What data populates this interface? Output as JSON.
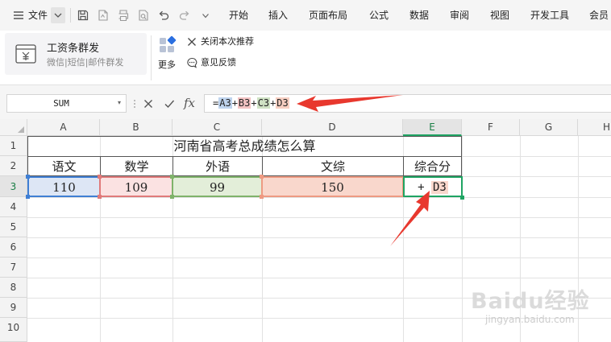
{
  "menubar": {
    "file_label": "文件",
    "tabs": [
      "开始",
      "插入",
      "页面布局",
      "公式",
      "数据",
      "审阅",
      "视图",
      "开发工具",
      "会员"
    ]
  },
  "ribbon": {
    "payroll_title": "工资条群发",
    "payroll_subtitle": "微信|短信|邮件群发",
    "more_label": "更多",
    "close_recommend_label": "关闭本次推荐",
    "feedback_label": "意见反馈"
  },
  "formula_bar": {
    "name_box": "SUM",
    "fx_label": "fx",
    "formula": {
      "eq": "=",
      "ref1": "A3",
      "op1": "+",
      "ref2": "B3",
      "op2": "+",
      "ref3": "C3",
      "op3": "+",
      "ref4": "D3"
    }
  },
  "sheet": {
    "columns": [
      "A",
      "B",
      "C",
      "D",
      "E",
      "F",
      "G",
      "H"
    ],
    "rows": [
      "1",
      "2",
      "3",
      "4",
      "5",
      "6",
      "7",
      "8",
      "9",
      "10"
    ],
    "active_column": "E",
    "active_row": "3",
    "title": "河南省高考总成绩怎么算",
    "headers": [
      "语文",
      "数学",
      "外语",
      "文综",
      "综合分"
    ],
    "values": [
      "110",
      "109",
      "99",
      "150"
    ],
    "editing_cell": {
      "op": "+",
      "ref": "D3"
    }
  },
  "colors": {
    "accent_green": "#1fa463",
    "annotation_red": "#e8382e",
    "ref_blue": "#3f7fd4",
    "ref_red": "#e07a7a",
    "ref_green": "#7fb36a",
    "ref_orange": "#ee9a82"
  },
  "watermark": {
    "brand": "Baidu经验",
    "url": "jingyan.baidu.com"
  }
}
